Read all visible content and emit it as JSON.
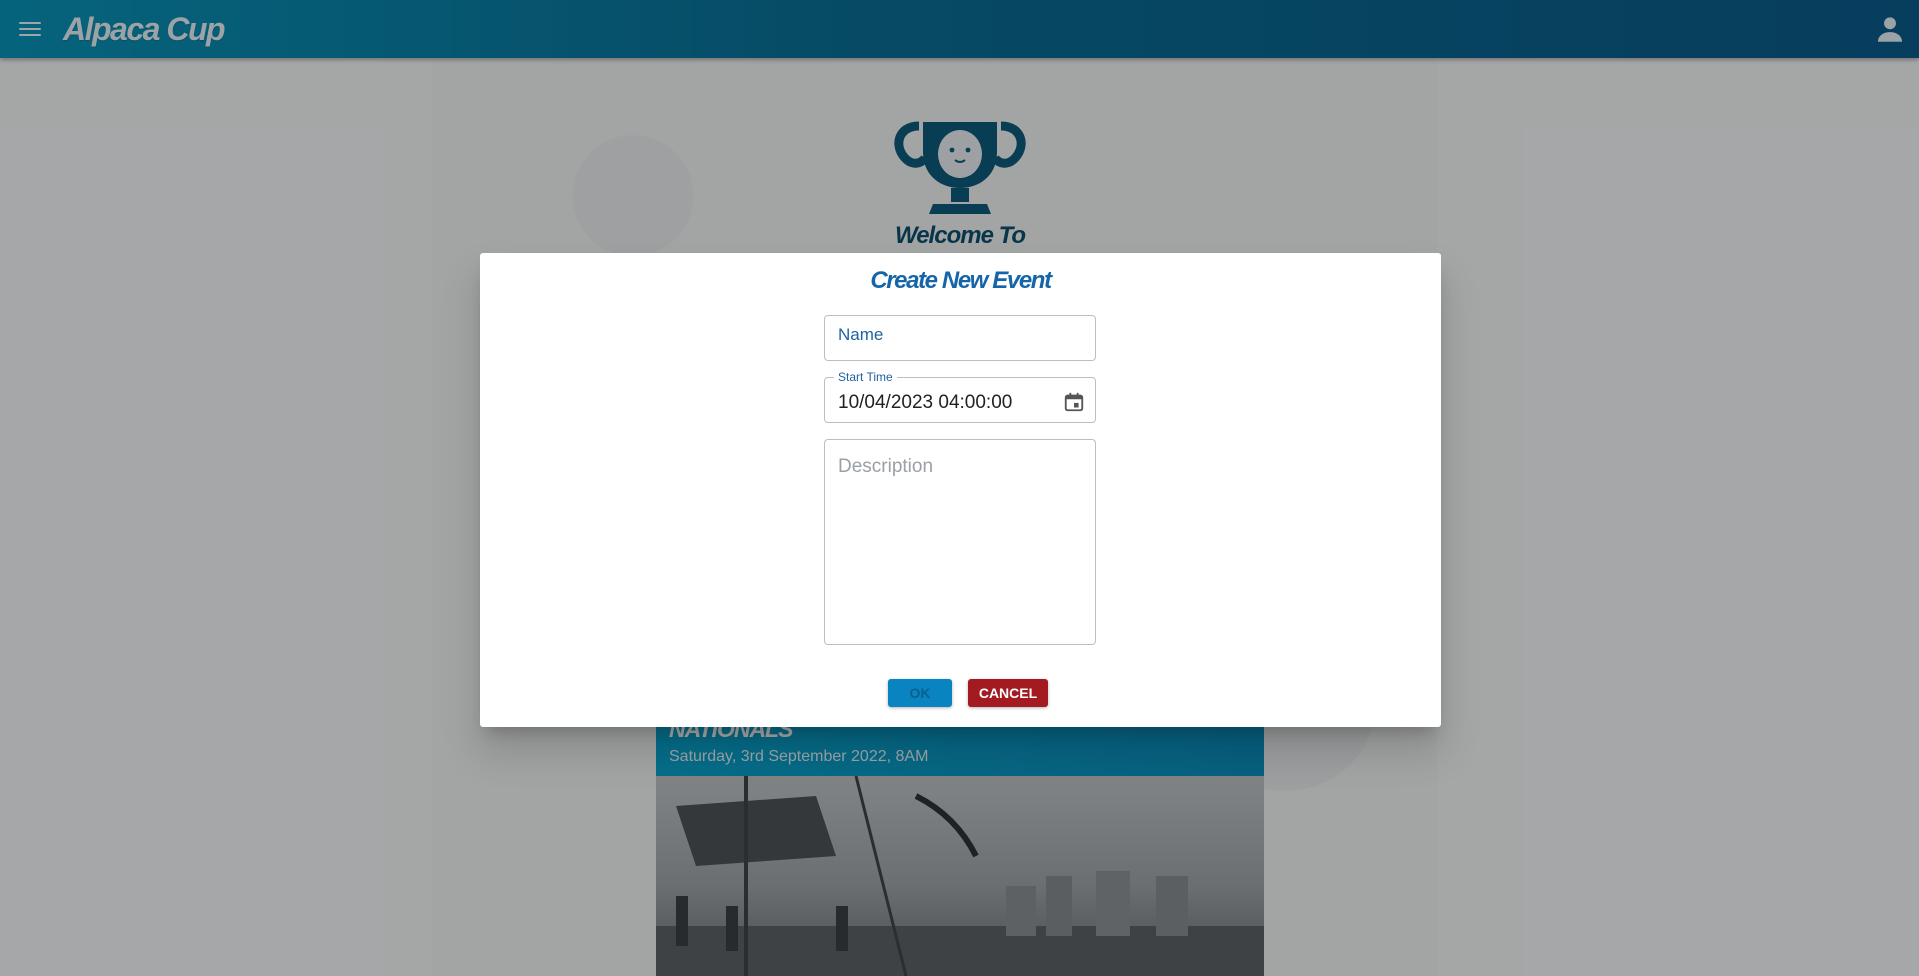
{
  "app": {
    "brand": "Alpaca Cup"
  },
  "background": {
    "welcome": "Welcome To",
    "event": {
      "title": "NATIONALS",
      "date": "Saturday, 3rd September 2022, 8AM"
    }
  },
  "dialog": {
    "title": "Create New Event",
    "name_placeholder": "Name",
    "start_time_label": "Start Time",
    "start_time_value": "10/04/2023 04:00:00",
    "description_placeholder": "Description",
    "ok_label": "OK",
    "cancel_label": "CANCEL"
  },
  "icons": {
    "menu": "menu-icon",
    "account": "account-icon",
    "calendar": "calendar-icon",
    "trophy": "trophy-logo"
  },
  "colors": {
    "topbar_start": "#0a93b8",
    "topbar_end": "#0b5a8a",
    "title_blue": "#1565a8",
    "ok_button": "#0a84c0",
    "cancel_button": "#a31b21"
  }
}
